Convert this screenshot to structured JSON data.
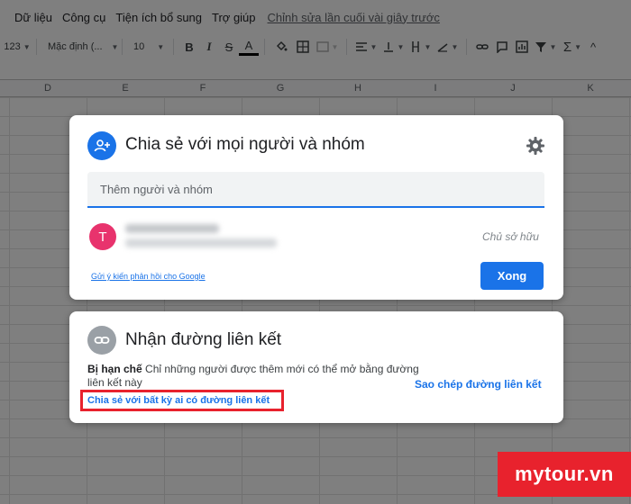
{
  "menu": {
    "items": [
      "Dữ liệu",
      "Công cụ",
      "Tiện ích bổ sung",
      "Trợ giúp"
    ],
    "last_edit": "Chỉnh sửa lần cuối vài giây trước"
  },
  "toolbar": {
    "number_format": "123",
    "font_name": "Mặc định (...",
    "font_size": "10",
    "bold": "B",
    "italic": "I",
    "strike": "S",
    "text_color": "A",
    "sum": "Σ"
  },
  "columns": [
    "D",
    "E",
    "F",
    "G",
    "H",
    "I",
    "J",
    "K"
  ],
  "share_dialog": {
    "title": "Chia sẻ với mọi người và nhóm",
    "add_placeholder": "Thêm người và nhóm",
    "avatar_letter": "T",
    "owner_role": "Chủ sở hữu",
    "feedback_link": "Gửi ý kiến phản hồi cho Google",
    "done_button": "Xong"
  },
  "link_dialog": {
    "title": "Nhận đường liên kết",
    "restriction_label": "Bị hạn chế",
    "restriction_text": "Chỉ những người được thêm mới có thể mở bằng đường liên kết này",
    "share_anyone_link": "Chia sẻ với bất kỳ ai có đường liên kết",
    "copy_link": "Sao chép đường liên kết"
  },
  "watermark": "mytour.vn",
  "colors": {
    "primary_blue": "#1a73e8",
    "avatar_pink": "#e8336d",
    "highlight_red": "#e8222d",
    "link_icon_gray": "#9aa0a6"
  }
}
